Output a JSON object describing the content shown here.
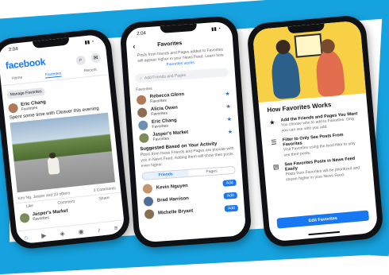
{
  "status": {
    "time": "2:04"
  },
  "feed": {
    "logo": "facebook",
    "tabs": [
      "Home",
      "Favorites",
      "Recent"
    ],
    "active_tab": "Favorites",
    "manage_label": "Manage Favorites",
    "post": {
      "author": "Eric Chang",
      "meta": "Favorites",
      "text": "Spent some time with Cleaver this evening"
    },
    "reactions": {
      "left": "Kim Ng, Jasper and 23 others",
      "right": "3 Comments"
    },
    "actions": [
      "Like",
      "Comment",
      "Share"
    ],
    "next_post": {
      "author": "Jasper's Market",
      "meta": "Favorites"
    }
  },
  "favorites": {
    "title": "Favorites",
    "description": "Posts from friends and Pages added to Favorites will appear higher in your News Feed. Learn how",
    "link": "Favorites works.",
    "search_placeholder": "Add Friends and Pages",
    "section_label": "Favorites",
    "items": [
      {
        "name": "Rebecca Glenn",
        "meta": "Favorites"
      },
      {
        "name": "Alicia Owen",
        "meta": "Favorites"
      },
      {
        "name": "Eric Chang",
        "meta": "Favorites"
      },
      {
        "name": "Jasper's Market",
        "meta": "Favorites"
      }
    ],
    "suggested_title": "Suggested Based on Your Activity",
    "suggested_desc": "Posts from these Friends and Pages are popular with you in News Feed. Adding them will show their posts even higher.",
    "segments": [
      "Friends",
      "Pages"
    ],
    "suggested": [
      {
        "name": "Kevin Nguyen",
        "button": "Add"
      },
      {
        "name": "Brad Harrison",
        "button": "Add"
      },
      {
        "name": "Michelle Bryant",
        "button": "Add"
      }
    ]
  },
  "how": {
    "title": "How Favorites Works",
    "items": [
      {
        "icon": "star-icon",
        "heading": "Add the Friends and Pages You Want",
        "body": "You choose who to add to Favorites. Only you can see who you add."
      },
      {
        "icon": "filter-icon",
        "heading": "Filter to Only See Posts From Favorites",
        "body": "Visit Favorites using the feed filter to only see their posts."
      },
      {
        "icon": "newsfeed-icon",
        "heading": "See Favorites Posts in News Feed Easily",
        "body": "Posts from Favorites will be prioritized and shown higher in your News Feed."
      }
    ],
    "cta": "Edit Favorites"
  },
  "colors": {
    "brand": "#1877f2",
    "stripe": "#16a2de",
    "illustration": "#f7d046"
  }
}
